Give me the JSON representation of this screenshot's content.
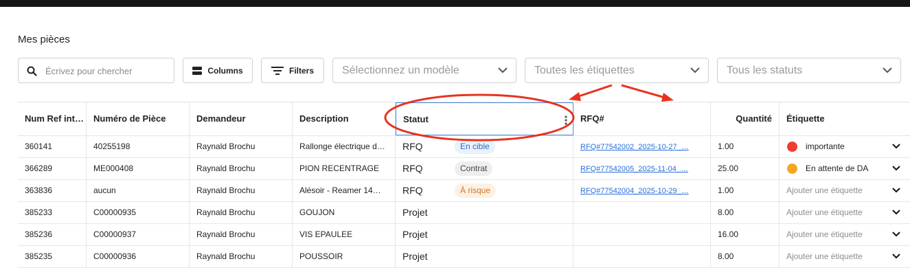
{
  "page": {
    "title": "Mes pièces"
  },
  "toolbar": {
    "search_placeholder": "Écrivez pour chercher",
    "columns_label": "Columns",
    "filters_label": "Filters",
    "model_select": "Sélectionnez un modèle",
    "tags_select": "Toutes les étiquettes",
    "status_select": "Tous les statuts"
  },
  "columns": [
    "Num Ref int…",
    "Numéro de Pièce",
    "Demandeur",
    "Description",
    "Statut",
    "RFQ#",
    "Quantité",
    "Étiquette"
  ],
  "rows": [
    {
      "ref": "360141",
      "piece": "40255198",
      "demandeur": "Raynald Brochu",
      "description": "Rallonge électrique d…",
      "statut": "RFQ",
      "chip": "En cible",
      "rfq": "RFQ#77542002_2025-10-27_…",
      "quantite": "1.00",
      "tag": "importante"
    },
    {
      "ref": "366289",
      "piece": "ME000408",
      "demandeur": "Raynald Brochu",
      "description": "PION RECENTRAGE",
      "statut": "RFQ",
      "chip": "Contrat",
      "rfq": "RFQ#77542005_2025-11-04_…",
      "quantite": "25.00",
      "tag": "En attente de DA"
    },
    {
      "ref": "363836",
      "piece": "aucun",
      "demandeur": "Raynald Brochu",
      "description": "Alésoir - Reamer 14…",
      "statut": "RFQ",
      "chip": "À risque",
      "rfq": "RFQ#77542004_2025-10-29_…",
      "quantite": "1.00",
      "tag": "Ajouter une étiquette"
    },
    {
      "ref": "385233",
      "piece": "C00000935",
      "demandeur": "Raynald Brochu",
      "description": "GOUJON",
      "statut": "Projet",
      "chip": "",
      "rfq": "",
      "quantite": "8.00",
      "tag": "Ajouter une étiquette"
    },
    {
      "ref": "385236",
      "piece": "C00000937",
      "demandeur": "Raynald Brochu",
      "description": "VIS EPAULEE",
      "statut": "Projet",
      "chip": "",
      "rfq": "",
      "quantite": "16.00",
      "tag": "Ajouter une étiquette"
    },
    {
      "ref": "385235",
      "piece": "C00000936",
      "demandeur": "Raynald Brochu",
      "description": "POUSSOIR",
      "statut": "Projet",
      "chip": "",
      "rfq": "",
      "quantite": "8.00",
      "tag": "Ajouter une étiquette"
    }
  ],
  "colors": {
    "tag_importante": "#f03b2f",
    "tag_attente": "#f5a623",
    "annotation": "#e8321f",
    "link": "#2a6fd6"
  }
}
